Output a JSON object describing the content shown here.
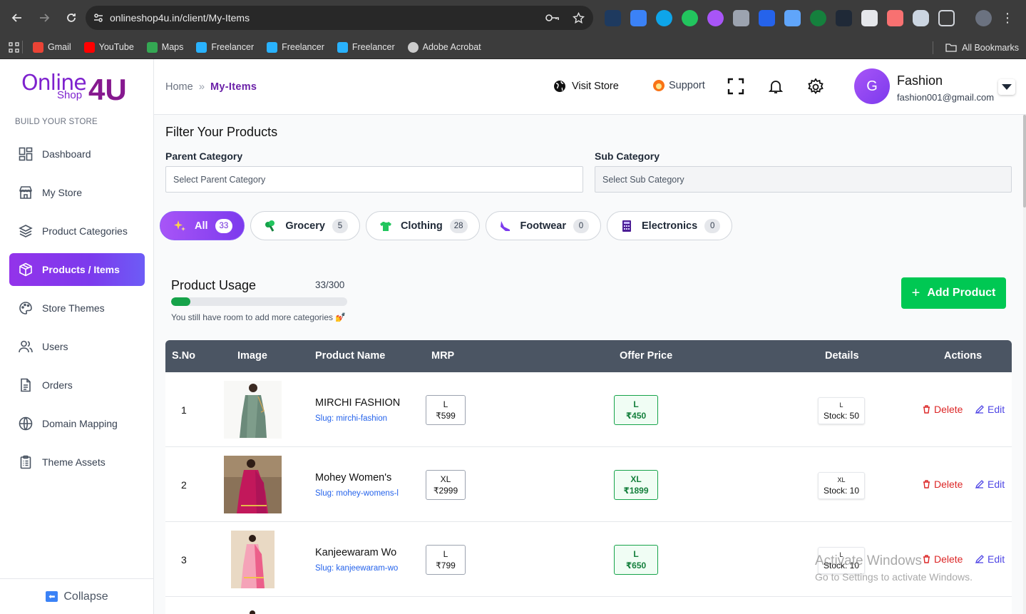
{
  "browser": {
    "url": "onlineshop4u.in/client/My-Items",
    "bookmarks": [
      {
        "label": "Gmail",
        "icon": "gmail-icon",
        "color": "#ea4335"
      },
      {
        "label": "YouTube",
        "icon": "youtube-icon",
        "color": "#ff0000"
      },
      {
        "label": "Maps",
        "icon": "maps-icon",
        "color": "#34a853"
      },
      {
        "label": "Freelancer",
        "icon": "freelancer-icon",
        "color": "#29b2fe"
      },
      {
        "label": "Freelancer",
        "icon": "freelancer-icon",
        "color": "#29b2fe"
      },
      {
        "label": "Freelancer",
        "icon": "freelancer-icon",
        "color": "#29b2fe"
      },
      {
        "label": "Adobe Acrobat",
        "icon": "globe-icon",
        "color": "#cccccc"
      }
    ],
    "all_bookmarks": "All Bookmarks"
  },
  "sidebar": {
    "logo": {
      "online": "Online",
      "shop": "Shop",
      "four_u": "4U"
    },
    "section_label": "BUILD YOUR STORE",
    "items": [
      {
        "label": "Dashboard",
        "icon": "dashboard-icon"
      },
      {
        "label": "My Store",
        "icon": "store-icon"
      },
      {
        "label": "Product Categories",
        "icon": "layers-icon"
      },
      {
        "label": "Products / Items",
        "icon": "box-icon",
        "active": true
      },
      {
        "label": "Store Themes",
        "icon": "palette-icon"
      },
      {
        "label": "Users",
        "icon": "users-icon"
      },
      {
        "label": "Orders",
        "icon": "document-icon"
      },
      {
        "label": "Domain Mapping",
        "icon": "globe-icon"
      },
      {
        "label": "Theme Assets",
        "icon": "clipboard-icon"
      }
    ],
    "collapse_label": "Collapse"
  },
  "header": {
    "breadcrumb": {
      "home": "Home",
      "separator": "»",
      "current": "My-Items"
    },
    "visit_store": "Visit Store",
    "support": "Support",
    "user": {
      "initial": "G",
      "name": "Fashion",
      "email": "fashion001@gmail.com"
    }
  },
  "filters": {
    "title": "Filter Your Products",
    "parent_label": "Parent Category",
    "parent_placeholder": "Select Parent Category",
    "sub_label": "Sub Category",
    "sub_placeholder": "Select Sub Category",
    "chips": [
      {
        "label": "All",
        "count": "33",
        "active": true
      },
      {
        "label": "Grocery",
        "count": "5"
      },
      {
        "label": "Clothing",
        "count": "28"
      },
      {
        "label": "Footwear",
        "count": "0"
      },
      {
        "label": "Electronics",
        "count": "0"
      }
    ]
  },
  "usage": {
    "title": "Product Usage",
    "count": "33/300",
    "fraction": 0.11,
    "note": "You still have room to add more categories 💅"
  },
  "add_product": "Add Product",
  "table": {
    "headers": [
      "S.No",
      "Image",
      "Product Name",
      "MRP",
      "Offer Price",
      "Details",
      "Actions"
    ],
    "rows": [
      {
        "sno": "1",
        "name": "MIRCHI FASHION",
        "slug": "Slug: mirchi-fashion",
        "mrp_size": "L",
        "mrp": "₹599",
        "offer_size": "L",
        "offer": "₹450",
        "det_size": "L",
        "stock": "Stock: 50",
        "delete": "Delete",
        "edit": "Edit"
      },
      {
        "sno": "2",
        "name": "Mohey Women's",
        "slug": "Slug: mohey-womens-l",
        "mrp_size": "XL",
        "mrp": "₹2999",
        "offer_size": "XL",
        "offer": "₹1899",
        "det_size": "XL",
        "stock": "Stock: 10",
        "delete": "Delete",
        "edit": "Edit"
      },
      {
        "sno": "3",
        "name": "Kanjeewaram Wo",
        "slug": "Slug: kanjeewaram-wo",
        "mrp_size": "L",
        "mrp": "₹799",
        "offer_size": "L",
        "offer": "₹650",
        "det_size": "L",
        "stock": "Stock: 10",
        "delete": "Delete",
        "edit": "Edit"
      }
    ]
  },
  "watermark": {
    "line1": "Activate Windows",
    "line2": "Go to Settings to activate Windows."
  }
}
